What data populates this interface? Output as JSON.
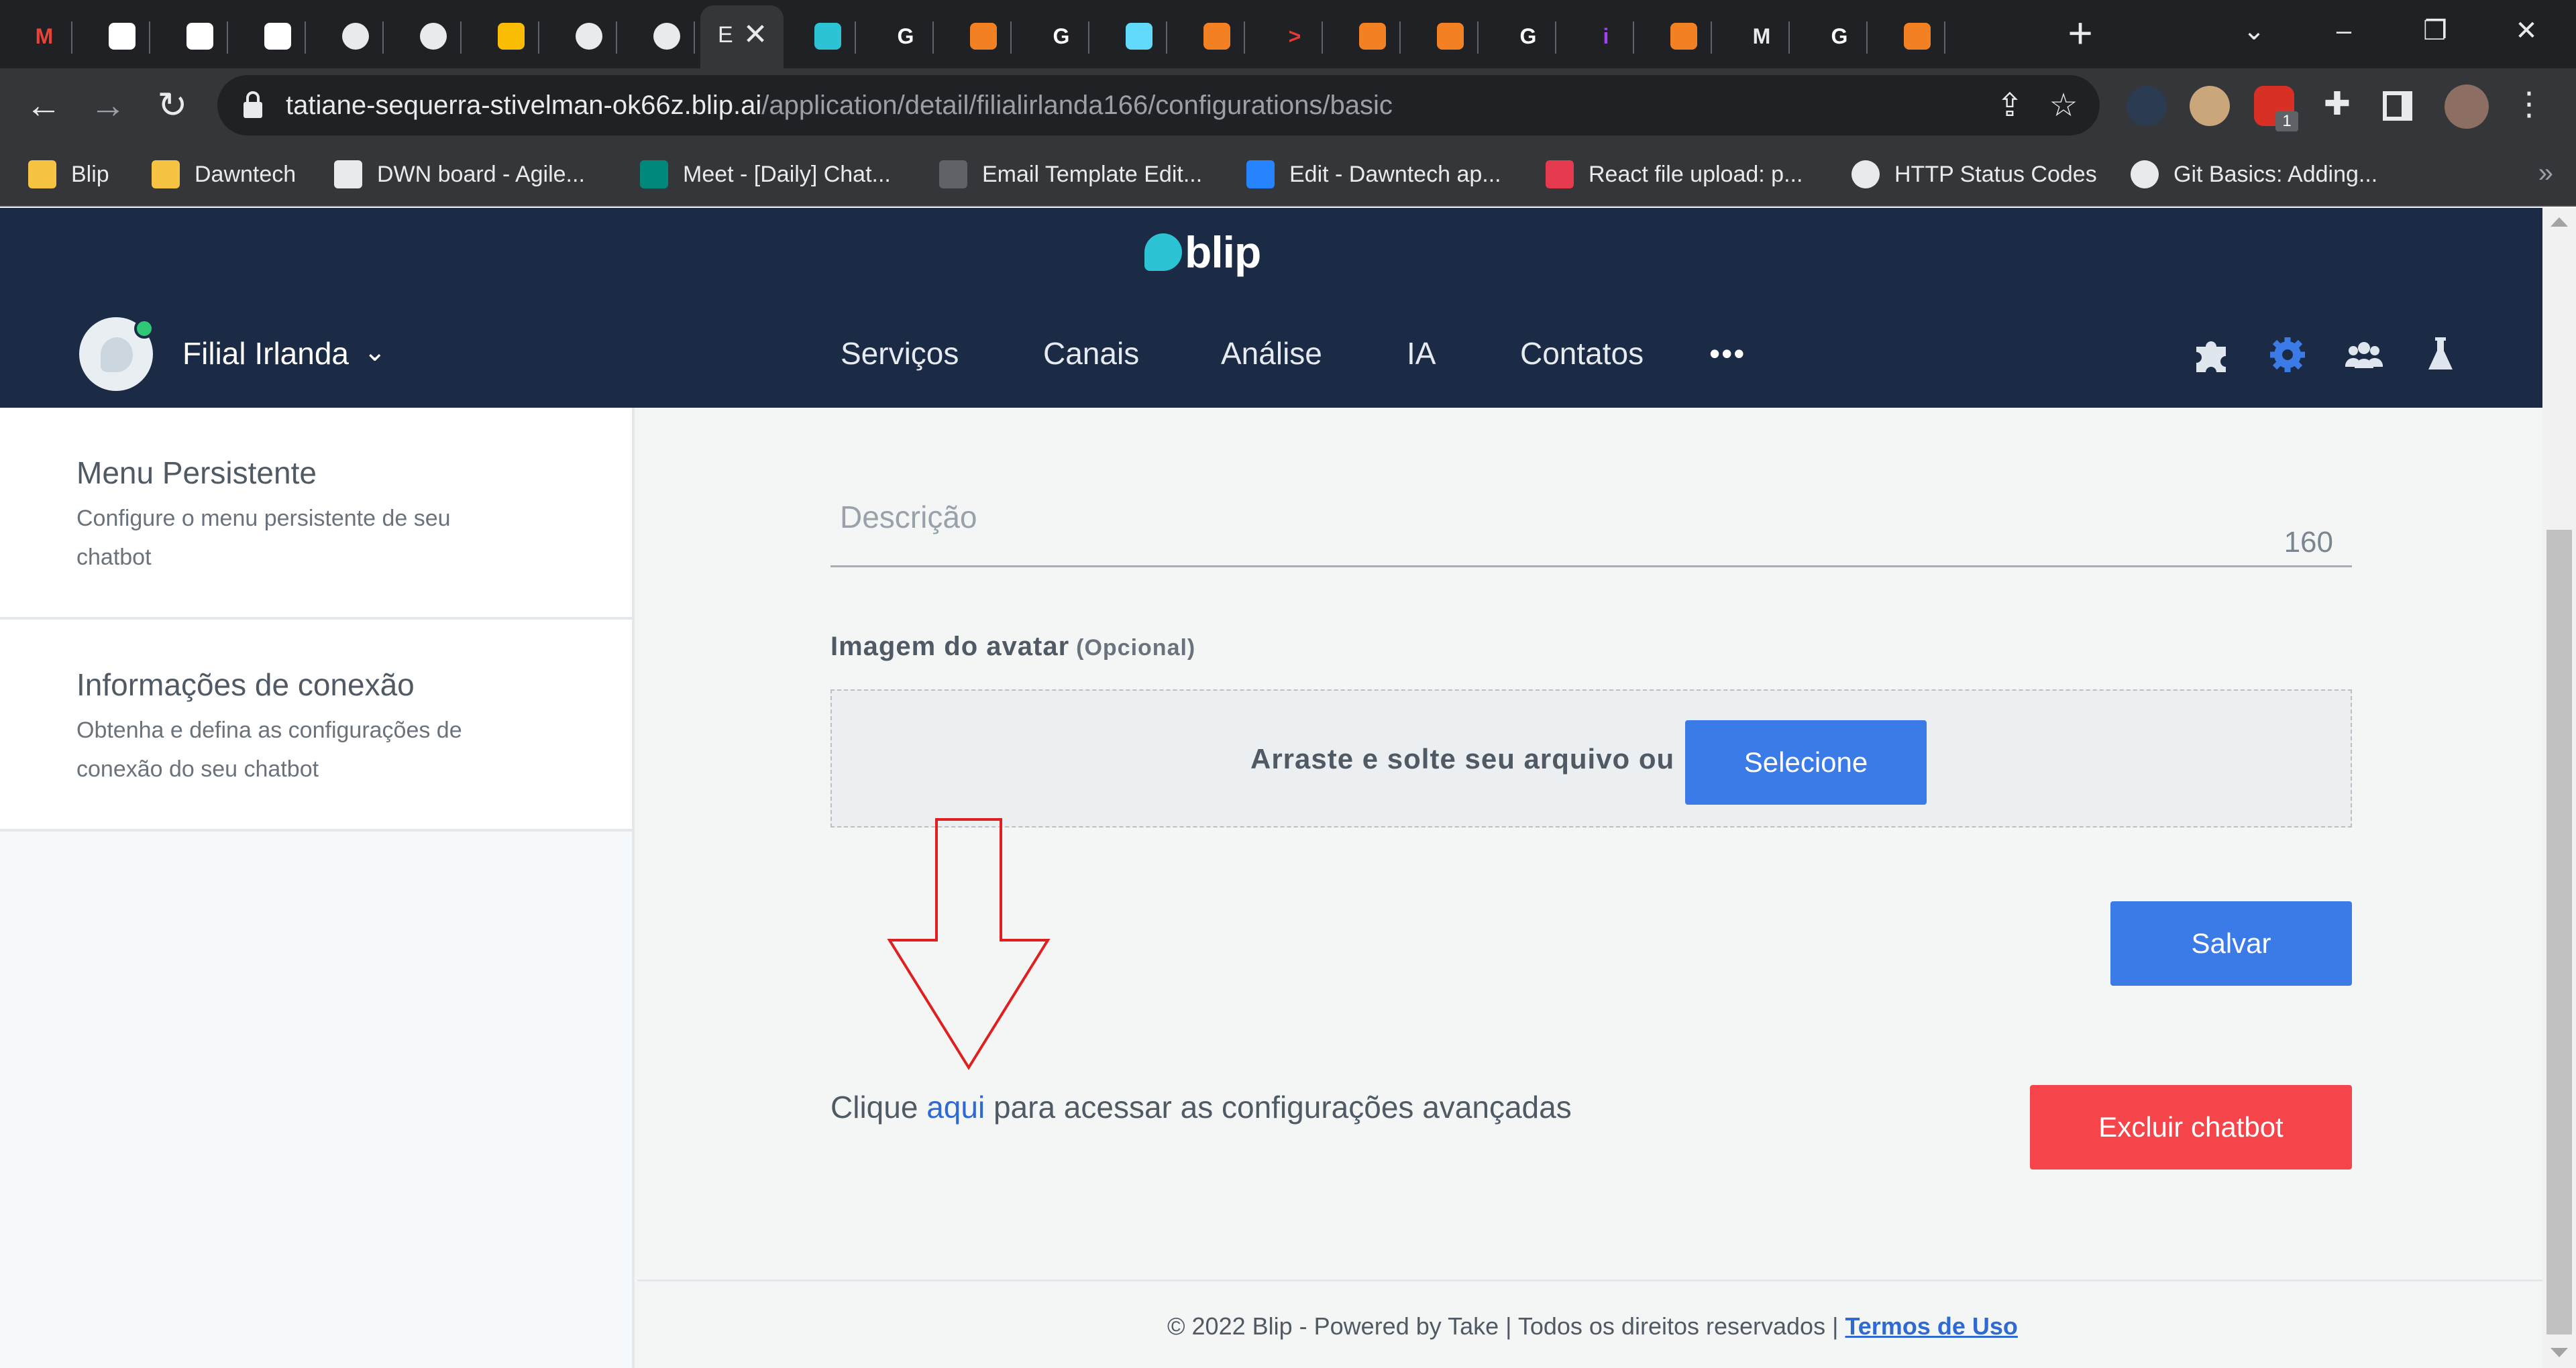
{
  "browser": {
    "active_tab_title": "E",
    "tabs": [
      {
        "icon": "gmail-icon",
        "color": "#ea4335",
        "glyph": "M"
      },
      {
        "icon": "blip-portal-icon",
        "color": "#ffffff",
        "glyph": ""
      },
      {
        "icon": "blip-portal-icon",
        "color": "#ffffff",
        "glyph": ""
      },
      {
        "icon": "blip-portal-icon",
        "color": "#ffffff",
        "glyph": ""
      },
      {
        "icon": "globe-icon",
        "color": "#e8eaed",
        "glyph": ""
      },
      {
        "icon": "github-icon",
        "color": "#e8eaed",
        "glyph": ""
      },
      {
        "icon": "keep-icon",
        "color": "#fbbc04",
        "glyph": ""
      },
      {
        "icon": "github-icon",
        "color": "#e8eaed",
        "glyph": ""
      },
      {
        "icon": "github-icon",
        "color": "#e8eaed",
        "glyph": ""
      },
      {
        "icon": "blip-icon",
        "color": "#2cc3d5",
        "glyph": ""
      },
      {
        "icon": "google-icon",
        "color": "#ffffff",
        "glyph": "G"
      },
      {
        "icon": "stackoverflow-icon",
        "color": "#f48024",
        "glyph": ""
      },
      {
        "icon": "google-icon",
        "color": "#ffffff",
        "glyph": "G"
      },
      {
        "icon": "react-icon",
        "color": "#61dafb",
        "glyph": ""
      },
      {
        "icon": "stackoverflow-icon",
        "color": "#f48024",
        "glyph": ""
      },
      {
        "icon": "prompt-icon",
        "color": "#e53935",
        "glyph": ">"
      },
      {
        "icon": "stackoverflow-icon",
        "color": "#f48024",
        "glyph": ""
      },
      {
        "icon": "stackoverflow-icon",
        "color": "#f48024",
        "glyph": ""
      },
      {
        "icon": "google-icon",
        "color": "#ffffff",
        "glyph": "G"
      },
      {
        "icon": "info-icon",
        "color": "#a142f4",
        "glyph": "i"
      },
      {
        "icon": "stackoverflow-icon",
        "color": "#f48024",
        "glyph": ""
      },
      {
        "icon": "medium-icon",
        "color": "#e8eaed",
        "glyph": "M"
      },
      {
        "icon": "google-icon",
        "color": "#ffffff",
        "glyph": "G"
      },
      {
        "icon": "stackoverflow-icon",
        "color": "#f48024",
        "glyph": ""
      }
    ],
    "url_host": "tatiane-sequerra-stivelman-ok66z.blip.ai",
    "url_path": "/application/detail/filialirlanda166/configurations/basic",
    "extension_badge": "1",
    "bookmarks": [
      {
        "label": "Blip",
        "icon": "folder-icon",
        "color": "#f6c343"
      },
      {
        "label": "Dawntech",
        "icon": "folder-icon",
        "color": "#f6c343"
      },
      {
        "label": "DWN board - Agile...",
        "icon": "agile-icon",
        "color": "#e8eaed"
      },
      {
        "label": "Meet - [Daily] Chat...",
        "icon": "meet-icon",
        "color": "#00897b"
      },
      {
        "label": "Email Template Edit...",
        "icon": "template-icon",
        "color": "#5f6368"
      },
      {
        "label": "Edit - Dawntech ap...",
        "icon": "confluence-icon",
        "color": "#2684ff"
      },
      {
        "label": "React file upload: p...",
        "icon": "ruby-icon",
        "color": "#e53950"
      },
      {
        "label": "HTTP Status Codes",
        "icon": "globe-icon",
        "color": "#e8eaed"
      },
      {
        "label": "Git Basics: Adding...",
        "icon": "globe-icon",
        "color": "#e8eaed"
      }
    ],
    "bookmarks_overflow": "»"
  },
  "app": {
    "logo_text": "blip",
    "bot_name": "Filial Irlanda",
    "nav": [
      "Serviços",
      "Canais",
      "Análise",
      "IA",
      "Contatos"
    ],
    "nav_more": "•••",
    "accent": "#3b7be8",
    "danger": "#f6454a",
    "header_bg": "#1b2a45"
  },
  "sidebar": {
    "items": [
      {
        "title": "Menu Persistente",
        "desc": "Configure o menu persistente de seu chatbot"
      },
      {
        "title": "Informações de conexão",
        "desc": "Obtenha e defina as configurações de conexão do seu chatbot"
      }
    ]
  },
  "form": {
    "description_label": "Descrição",
    "description_counter": "160",
    "avatar_label": "Imagem do avatar",
    "avatar_optional": "(Opcional)",
    "dropzone_text": "Arraste e solte seu arquivo ou",
    "select_button": "Selecione",
    "save_button": "Salvar",
    "advanced_prefix": "Clique",
    "advanced_link": "aqui",
    "advanced_suffix": "para acessar as configurações avançadas",
    "delete_button": "Excluir chatbot"
  },
  "footer": {
    "text": "© 2022 Blip - Powered by Take | Todos os direitos reservados |",
    "terms_link": "Termos de Uso"
  }
}
